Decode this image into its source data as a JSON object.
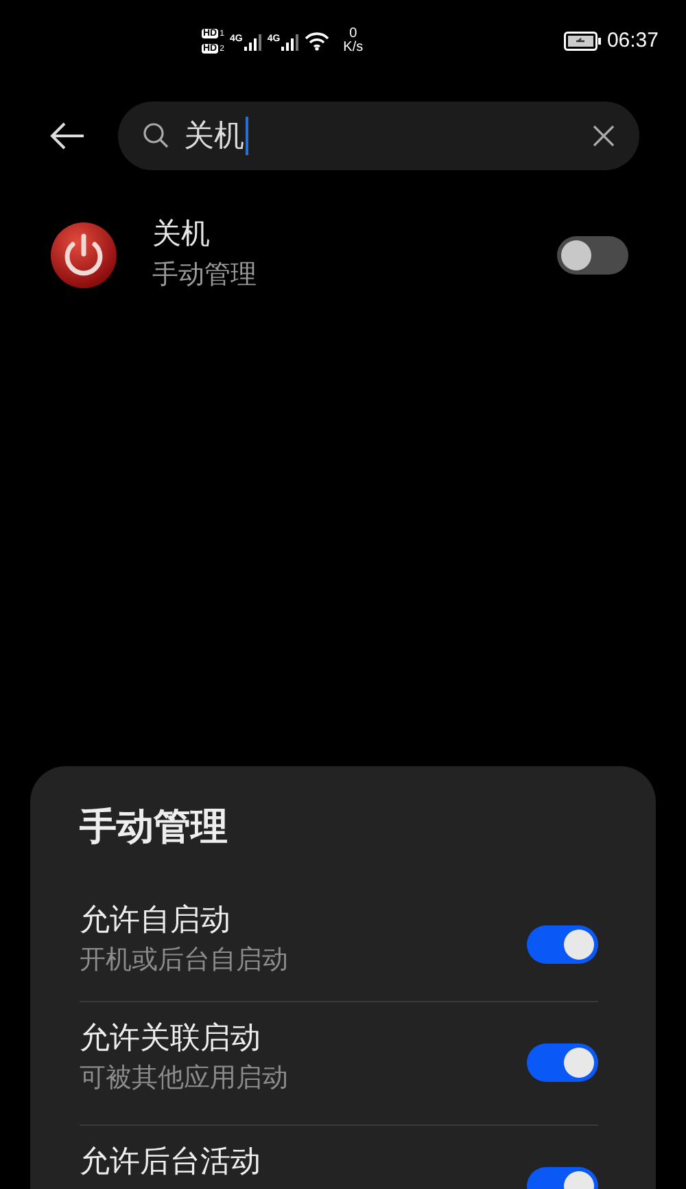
{
  "status_bar": {
    "sims": [
      {
        "label": "HD",
        "slot": "1"
      },
      {
        "label": "HD",
        "slot": "2"
      }
    ],
    "networks": [
      "4G",
      "4G"
    ],
    "speed_value": "0",
    "speed_unit": "K/s",
    "time": "06:37"
  },
  "search": {
    "value": "关机"
  },
  "results": [
    {
      "title": "关机",
      "subtitle": "手动管理",
      "on": false
    }
  ],
  "sheet": {
    "title": "手动管理",
    "rows": [
      {
        "title": "允许自启动",
        "subtitle": "开机或后台自启动",
        "on": true
      },
      {
        "title": "允许关联启动",
        "subtitle": "可被其他应用启动",
        "on": true
      },
      {
        "title": "允许后台活动",
        "on": true
      }
    ]
  }
}
